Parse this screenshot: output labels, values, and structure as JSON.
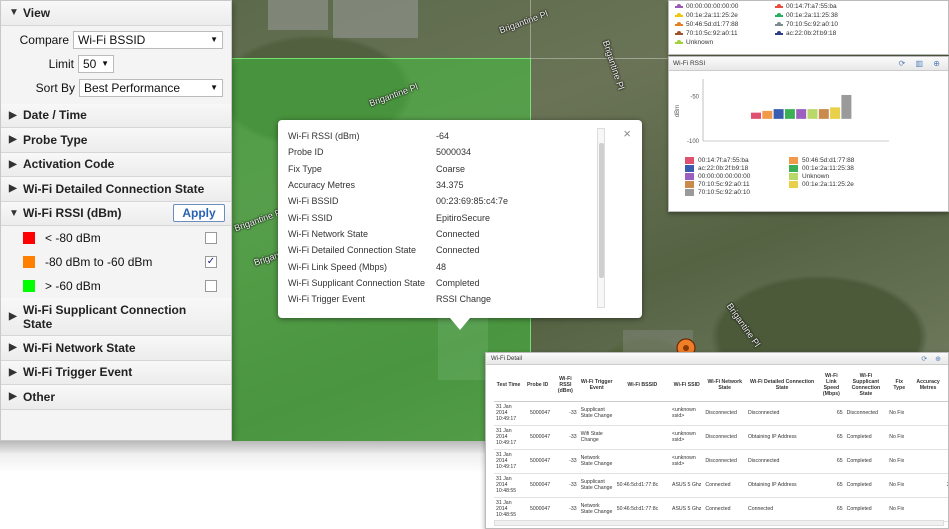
{
  "map": {
    "streets": [
      "Brigantine Pl",
      "Brigantine Pl",
      "Brigantine Pl",
      "Brigantine Pl",
      "Brigantine Pl",
      "Brigantine Pl"
    ]
  },
  "popup": {
    "rows": [
      {
        "k": "Wi-Fi RSSI (dBm)",
        "v": "-64"
      },
      {
        "k": "Probe ID",
        "v": "5000034"
      },
      {
        "k": "Fix Type",
        "v": "Coarse"
      },
      {
        "k": "Accuracy Metres",
        "v": "34.375"
      },
      {
        "k": "Wi-Fi BSSID",
        "v": "00:23:69:85:c4:7e"
      },
      {
        "k": "Wi-Fi SSID",
        "v": "EpitiroSecure"
      },
      {
        "k": "Wi-Fi Network State",
        "v": "Connected"
      },
      {
        "k": "Wi-Fi Detailed Connection State",
        "v": "Connected"
      },
      {
        "k": "Wi-Fi Link Speed (Mbps)",
        "v": "48"
      },
      {
        "k": "Wi-Fi Supplicant Connection State",
        "v": "Completed"
      },
      {
        "k": "Wi-Fi Trigger Event",
        "v": "RSSI Change"
      }
    ],
    "close": "×"
  },
  "panel": {
    "view": "View",
    "compare_label": "Compare",
    "compare_value": "Wi-Fi BSSID",
    "limit_label": "Limit",
    "limit_value": "50",
    "sortby_label": "Sort By",
    "sortby_value": "Best Performance",
    "sections_top": [
      "Date / Time",
      "Probe Type",
      "Activation Code",
      "Wi-Fi Detailed Connection State"
    ],
    "rssi_title": "Wi-Fi RSSI (dBm)",
    "apply": "Apply",
    "rssi_items": [
      {
        "label": "< -80 dBm",
        "color": "#ff0000",
        "checked": false
      },
      {
        "label": "-80 dBm to -60 dBm",
        "color": "#ff7f00",
        "checked": true
      },
      {
        "label": "> -60 dBm",
        "color": "#00ff00",
        "checked": false
      }
    ],
    "supplicant": "Wi-Fi Supplicant Connection State",
    "sections_bottom": [
      "Wi-Fi Network State",
      "Wi-Fi Trigger Event",
      "Other"
    ]
  },
  "legend_card": {
    "items": [
      {
        "label": "00:00:00:00:00:00",
        "color": "#9b59b6"
      },
      {
        "label": "00:14:7f:a7:55:ba",
        "color": "#e74c3c"
      },
      {
        "label": "00:1e:2a:11:25:2e",
        "color": "#f1c40f"
      },
      {
        "label": "00:1e:2a:11:25:38",
        "color": "#27ae60"
      },
      {
        "label": "50:46:5d:d1:77:88",
        "color": "#e67e22"
      },
      {
        "label": "70:10:5c:92:a0:10",
        "color": "#7f8c8d"
      },
      {
        "label": "70:10:5c:92:a0:11",
        "color": "#a0522d"
      },
      {
        "label": "ac:22:0b:2f:b9:18",
        "color": "#2c3e8c"
      },
      {
        "label": "Unknown",
        "color": "#a3d13b"
      }
    ]
  },
  "rssi_card": {
    "title": "Wi-Fi RSSI",
    "icons": "⟳ ▥ ⊕",
    "ylabel": "dBm",
    "ticks": [
      "-100",
      "-50"
    ],
    "legend": [
      {
        "label": "00:14:7f:a7:55:ba",
        "color": "#e05070"
      },
      {
        "label": "50:46:5d:d1:77:88",
        "color": "#f09a4a"
      },
      {
        "label": "ac:22:0b:2f:b9:18",
        "color": "#3b5db0"
      },
      {
        "label": "00:1e:2a:11:25:38",
        "color": "#3cb054"
      },
      {
        "label": "00:00:00:00:00:00",
        "color": "#9b5fc0"
      },
      {
        "label": "Unknown",
        "color": "#b8d96a"
      },
      {
        "label": "70:10:5c:92:a0:11",
        "color": "#c98a4b"
      },
      {
        "label": "00:1e:2a:11:25:2e",
        "color": "#e8d04a"
      },
      {
        "label": "70:10:5c:92:a0:10",
        "color": "#9a9a9a"
      }
    ]
  },
  "chart_data": {
    "type": "bar",
    "title": "Wi-Fi RSSI",
    "ylabel": "dBm",
    "ylim": [
      -100,
      -30
    ],
    "categories": [
      "00:14:7f:a7:55:ba",
      "50:46:5d:d1:77:88",
      "ac:22:0b:2f:b9:18",
      "00:1e:2a:11:25:38",
      "00:00:00:00:00:00",
      "Unknown",
      "70:10:5c:92:a0:11",
      "00:1e:2a:11:25:2e",
      "70:10:5c:92:a0:10"
    ],
    "values": [
      -68,
      -66,
      -64,
      -64,
      -64,
      -64,
      -64,
      -62,
      -48
    ],
    "colors": [
      "#e05070",
      "#f09a4a",
      "#3b5db0",
      "#3cb054",
      "#9b5fc0",
      "#b8d96a",
      "#c98a4b",
      "#e8d04a",
      "#9a9a9a"
    ]
  },
  "detail_card": {
    "title": "Wi-Fi Detail",
    "icons": "⟳ ⊕",
    "columns": [
      "Test Time",
      "Probe ID",
      "Wi-Fi RSSI (dBm)",
      "Wi-Fi Trigger Event",
      "Wi-Fi BSSID",
      "Wi-Fi SSID",
      "Wi-Fi Network State",
      "Wi-Fi Detailed Connection State",
      "Wi-Fi Link Speed (Mbps)",
      "Wi-Fi Supplicant Connection State",
      "Fix Type",
      "Accuracy Metres",
      "Wi St Dura (ms"
    ],
    "rows": [
      [
        "31 Jan 2014 10:49:17",
        "5000047",
        "-33",
        "Supplicant State Change",
        "",
        "<unknown ssid>",
        "Disconnected",
        "Disconnected",
        "65",
        "Disconnected",
        "No Fix",
        "",
        ""
      ],
      [
        "31 Jan 2014 10:49:17",
        "5000047",
        "-33",
        "Wifi State Change",
        "",
        "<unknown ssid>",
        "Disconnected",
        "Obtaining IP Address",
        "65",
        "Completed",
        "No Fix",
        "",
        ""
      ],
      [
        "31 Jan 2014 10:49:17",
        "5000047",
        "-33",
        "Network State Change",
        "",
        "<unknown ssid>",
        "Disconnected",
        "Disconnected",
        "65",
        "Completed",
        "No Fix",
        "",
        ""
      ],
      [
        "31 Jan 2014 10:48:55",
        "5000047",
        "-33",
        "Supplicant State Change",
        "50:46:5d:d1:77:8c",
        "ASUS 5 Ghz",
        "Connected",
        "Obtaining IP Address",
        "65",
        "Completed",
        "No Fix",
        "",
        "2"
      ],
      [
        "31 Jan 2014 10:48:55",
        "5000047",
        "-33",
        "Network State Change",
        "50:46:5d:d1:77:8c",
        "ASUS 5 Ghz",
        "Connected",
        "Connected",
        "65",
        "Completed",
        "No Fix",
        "",
        ""
      ]
    ]
  }
}
